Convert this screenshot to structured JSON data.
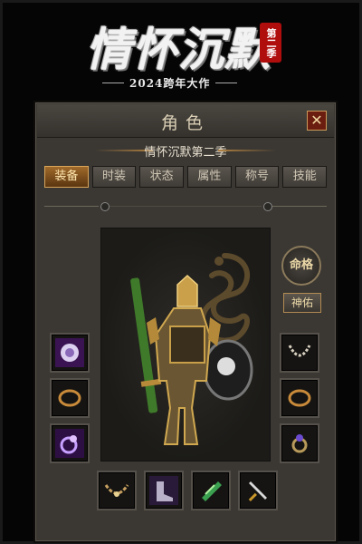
{
  "logo": {
    "main": "情怀沉默",
    "seal": "第二季",
    "subtitle": "2024跨年大作"
  },
  "window": {
    "title": "角色",
    "close_label": "✕"
  },
  "character": {
    "name": "情怀沉默第二季"
  },
  "tabs": [
    {
      "label": "装备",
      "active": true
    },
    {
      "label": "时装",
      "active": false
    },
    {
      "label": "状态",
      "active": false
    },
    {
      "label": "属性",
      "active": false
    },
    {
      "label": "称号",
      "active": false
    },
    {
      "label": "技能",
      "active": false
    }
  ],
  "buttons": {
    "fate": "命格",
    "blessing": "神佑"
  },
  "equipment": {
    "left": [
      {
        "icon": "helmet-medal-icon"
      },
      {
        "icon": "bracelet-icon"
      },
      {
        "icon": "ring-icon"
      }
    ],
    "right": [
      {
        "icon": "necklace-icon"
      },
      {
        "icon": "bracelet-icon"
      },
      {
        "icon": "ring-icon"
      }
    ],
    "bottom": [
      {
        "icon": "belt-icon"
      },
      {
        "icon": "boots-icon"
      },
      {
        "icon": "gem-icon"
      },
      {
        "icon": "dagger-icon"
      }
    ]
  },
  "colors": {
    "accent": "#a06a2a",
    "panel": "#3b3833",
    "close": "#6b1e10"
  }
}
